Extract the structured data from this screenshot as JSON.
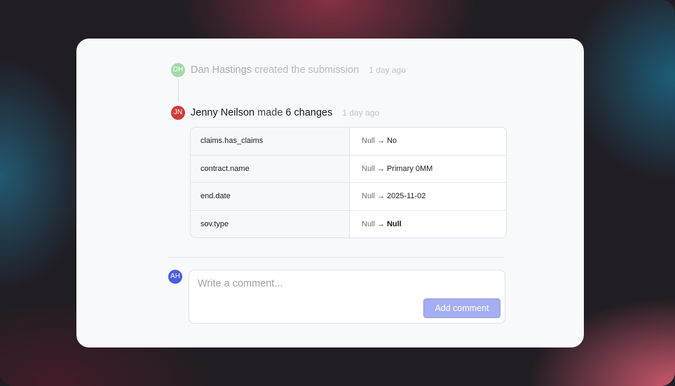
{
  "timeline": {
    "event1": {
      "avatar_initials": "DH",
      "user": "Dan Hastings",
      "action": "created the submission",
      "time": "1 day ago"
    },
    "event2": {
      "avatar_initials": "JN",
      "user": "Jenny Neilson",
      "action": "made",
      "changes_count": "6 changes",
      "time": "1 day ago",
      "changes": [
        {
          "field": "claims.has_claims",
          "from": "Null",
          "to": "No"
        },
        {
          "field": "contract.name",
          "from": "Null",
          "to": "Primary 0MM"
        },
        {
          "field": "end.date",
          "from": "Null",
          "to": "2025-11-02"
        },
        {
          "field": "sov.type",
          "from": "Null",
          "to": "Null"
        }
      ]
    }
  },
  "comment": {
    "avatar_initials": "AH",
    "placeholder": "Write a comment...",
    "button_label": "Add comment"
  },
  "icons": {
    "change_arrow": "arrow-right-icon"
  },
  "colors": {
    "accent_button": "#a5aef2",
    "avatar_dh": "#a3d9a8",
    "avatar_jn": "#d33b3b",
    "avatar_ah": "#4a5de0"
  }
}
